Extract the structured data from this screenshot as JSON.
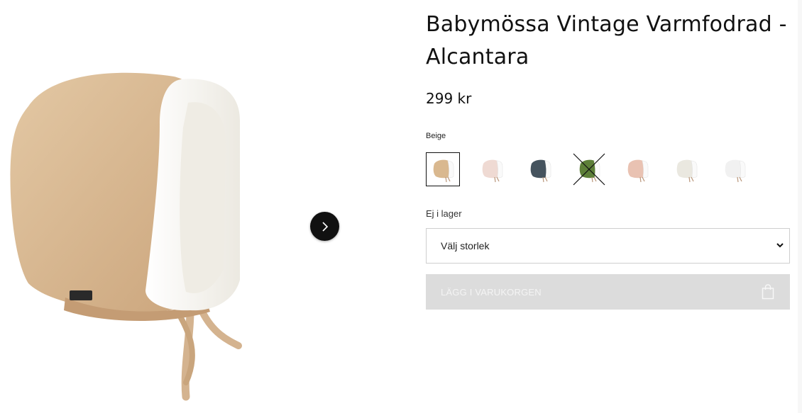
{
  "product": {
    "title_line1": "Babymössa Vintage Varmfodrad -",
    "title_line2": "Alcantara",
    "price": "299 kr",
    "selected_color": "Beige",
    "stock_status": "Ej i lager",
    "size_select": {
      "selected": "Välj storlek",
      "options": [
        "Välj storlek"
      ]
    },
    "add_to_cart_label": "LÄGG I VARUKORGEN"
  },
  "swatches": [
    {
      "name": "beige",
      "color": "#d9b88f",
      "selected": true,
      "available": true
    },
    {
      "name": "floral",
      "color": "#efdad3",
      "selected": false,
      "available": true
    },
    {
      "name": "navy",
      "color": "#45535e",
      "selected": false,
      "available": true
    },
    {
      "name": "green",
      "color": "#5d7f38",
      "selected": false,
      "available": false
    },
    {
      "name": "pink",
      "color": "#e9c2b2",
      "selected": false,
      "available": true
    },
    {
      "name": "print",
      "color": "#eae8e0",
      "selected": false,
      "available": true
    },
    {
      "name": "white",
      "color": "#f1f1f1",
      "selected": false,
      "available": true
    }
  ],
  "icons": {
    "next": "chevron-right-icon",
    "select": "chevron-down-icon",
    "cart": "shopping-bag-icon"
  },
  "colors": {
    "text": "#111111",
    "disabled_button": "#dcdcdc",
    "border": "#cfcfcf"
  }
}
